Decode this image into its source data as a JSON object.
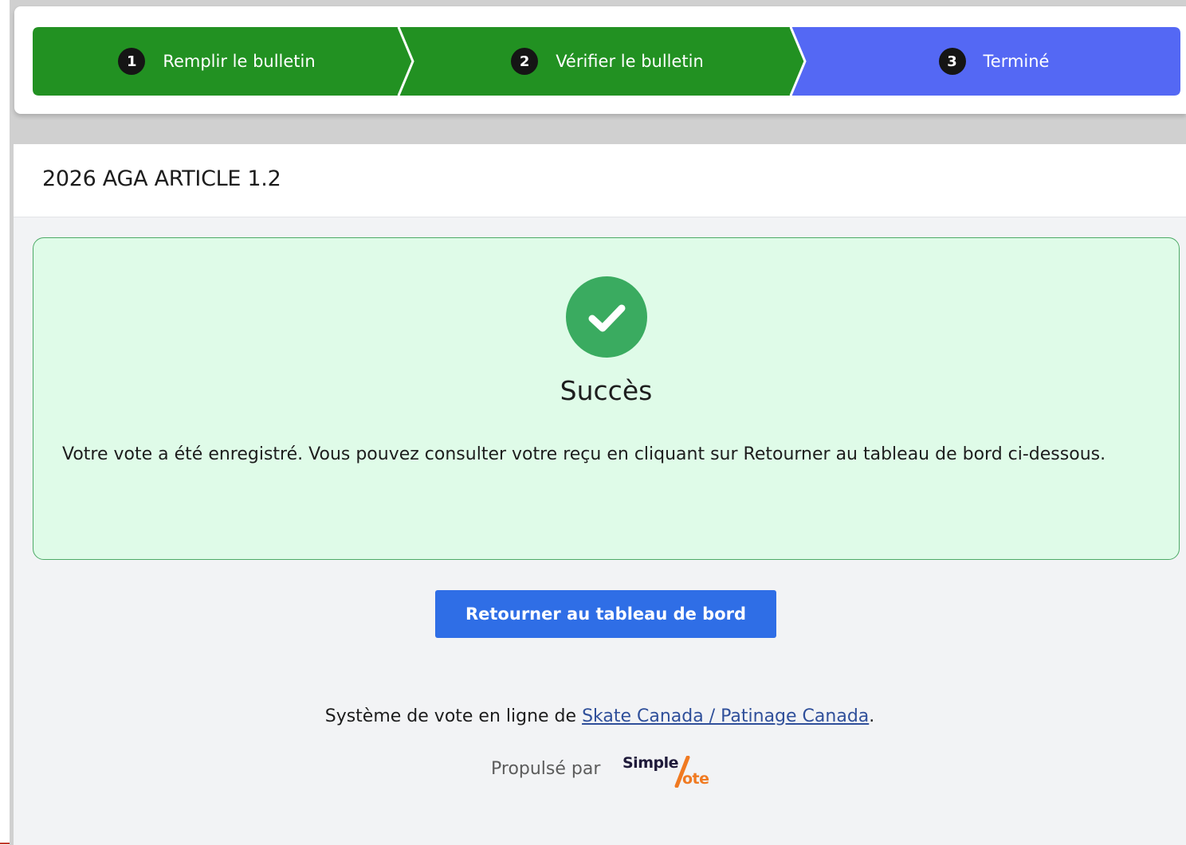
{
  "stepper": {
    "steps": [
      {
        "number": "1",
        "label": "Remplir le bulletin",
        "state": "completed"
      },
      {
        "number": "2",
        "label": "Vérifier le bulletin",
        "state": "completed"
      },
      {
        "number": "3",
        "label": "Terminé",
        "state": "active"
      }
    ],
    "colors": {
      "completed": "#229122",
      "active": "#5468f4"
    }
  },
  "ballot": {
    "title": "2026 AGA ARTICLE 1.2"
  },
  "success": {
    "icon": "check-circle-icon",
    "title": "Succès",
    "message": "Votre vote a été enregistré. Vous pouvez consulter votre reçu en cliquant sur Retourner au tableau de bord ci-dessous.",
    "colors": {
      "background": "#dffbe8",
      "border": "#4caa66",
      "icon": "#3aab60"
    }
  },
  "actions": {
    "return_label": "Retourner au tableau de bord",
    "color": "#2f6ee6"
  },
  "footer": {
    "prefix": "Système de vote en ligne de ",
    "link_text": "Skate Canada / Patinage Canada",
    "suffix": ".",
    "powered_by": "Propulsé par",
    "logo_text_top": "Simple",
    "logo_text_bottom": "ote"
  }
}
